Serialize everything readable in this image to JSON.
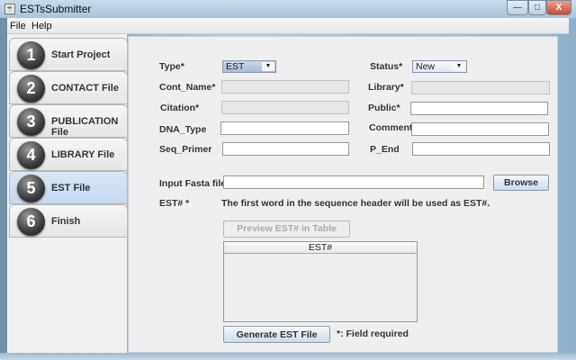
{
  "window": {
    "title": "ESTsSubmitter",
    "minimize": "—",
    "maximize": "□",
    "close": "X"
  },
  "menu": [
    "File",
    "Help"
  ],
  "steps": [
    {
      "num": "1",
      "label": "Start Project"
    },
    {
      "num": "2",
      "label": "CONTACT File"
    },
    {
      "num": "3",
      "label": "PUBLICATION File"
    },
    {
      "num": "4",
      "label": "LIBRARY File"
    },
    {
      "num": "5",
      "label": "EST File",
      "active": true
    },
    {
      "num": "6",
      "label": "Finish"
    }
  ],
  "form": {
    "type_label": "Type*",
    "type_value": "EST",
    "status_label": "Status*",
    "status_value": "New",
    "cont_name_label": "Cont_Name*",
    "library_label": "Library*",
    "citation_label": "Citation*",
    "public_label": "Public*",
    "dna_type_label": "DNA_Type",
    "comment_label": "Comment",
    "seq_primer_label": "Seq_Primer",
    "p_end_label": "P_End",
    "fasta_label": "Input Fasta file*",
    "browse": "Browse",
    "est_label": "EST# *",
    "est_note": "The first word in the sequence header will be used as EST#.",
    "preview": "Preview EST# in Table",
    "table_header": "EST#",
    "generate": "Generate EST File",
    "required_note": "*: Field required"
  }
}
